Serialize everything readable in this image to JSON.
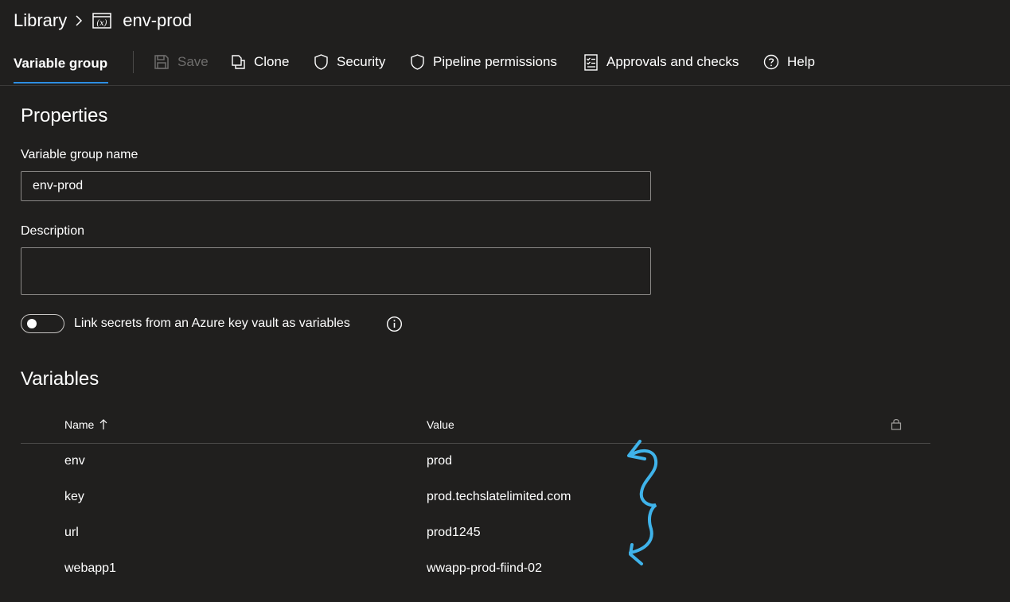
{
  "breadcrumb": {
    "root": "Library",
    "current": "env-prod"
  },
  "toolbar": {
    "active_tab": "Variable group",
    "save": "Save",
    "clone": "Clone",
    "security": "Security",
    "pipeline_permissions": "Pipeline permissions",
    "approvals": "Approvals and checks",
    "help": "Help"
  },
  "properties": {
    "heading": "Properties",
    "name_label": "Variable group name",
    "name_value": "env-prod",
    "description_label": "Description",
    "description_value": "",
    "keyvault_toggle_label": "Link secrets from an Azure key vault as variables"
  },
  "variables": {
    "heading": "Variables",
    "col_name": "Name",
    "col_value": "Value",
    "rows": [
      {
        "name": "env",
        "value": "prod"
      },
      {
        "name": "key",
        "value": "prod.techslatelimited.com"
      },
      {
        "name": "url",
        "value": "prod1245"
      },
      {
        "name": "webapp1",
        "value": "wwapp-prod-fiind-02"
      }
    ]
  },
  "colors": {
    "background": "#201f1e",
    "accent": "#2d8ee3",
    "annotation": "#3fb3ea"
  },
  "icons": [
    "chevron-right-icon",
    "variable-group-icon",
    "save-icon",
    "clone-icon",
    "shield-icon",
    "checklist-icon",
    "help-icon",
    "info-icon",
    "lock-icon",
    "sort-up-icon"
  ]
}
